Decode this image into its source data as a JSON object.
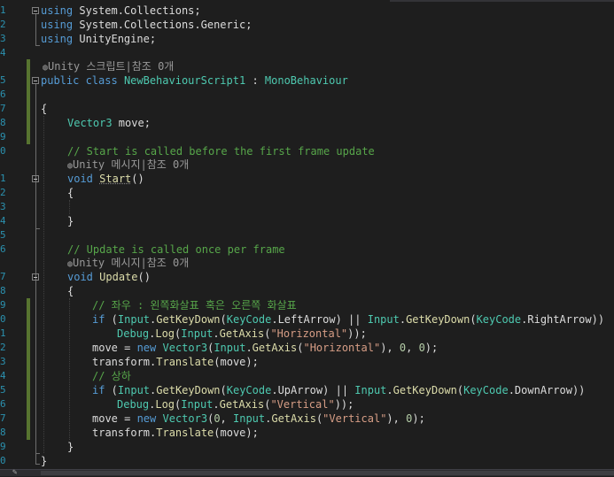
{
  "line_numbers": [
    "1",
    "2",
    "3",
    "4",
    "5",
    "6",
    "7",
    "8",
    "9",
    "0",
    "1",
    "2",
    "3",
    "4",
    "5",
    "6",
    "7",
    "8",
    "9",
    "0",
    "1",
    "2",
    "3",
    "4",
    "5",
    "6",
    "7",
    "8",
    "9",
    "0"
  ],
  "code": {
    "l1_kw": "using",
    "l1_rest": " System.Collections;",
    "l2_kw": "using",
    "l2_rest": " System.Collections.Generic;",
    "l3_kw": "using",
    "l3_rest": " UnityEngine;",
    "lens1_icon": "◍",
    "lens1_text": "Unity 스크립트|참조 0개",
    "l5_kw1": "public",
    "l5_kw2": " class ",
    "l5_type": "NewBehaviourScript1",
    "l5_colon": " : ",
    "l5_base": "MonoBehaviour",
    "l6_brace": "{",
    "l7_type": "Vector3",
    "l7_rest": " move;",
    "l9_comment": "// Start is called before the first frame update",
    "lens2_icon": "◍",
    "lens2_text": "Unity 메시지|참조 0개",
    "l10_kw": "void",
    "l10_fn": "Start",
    "l10_paren": "()",
    "l11_brace": "{",
    "l13_brace": "}",
    "l15_comment": "// Update is called once per frame",
    "lens3_icon": "◍",
    "lens3_text": "Unity 메시지|참조 0개",
    "l16_kw": "void",
    "l16_fn": "Update",
    "l16_paren": "()",
    "l17_brace": "{",
    "l18_comment": "// 좌우 : 왼쪽화살표 혹은 오른쪽 화살표",
    "l19_if": "if",
    "l19_p1": " (",
    "l19_input1": "Input",
    "l19_dot1": ".",
    "l19_fn1": "GetKeyDown",
    "l19_p2": "(",
    "l19_kc1": "KeyCode",
    "l19_dot2": ".",
    "l19_arg1": "LeftArrow",
    "l19_p3": ") || ",
    "l19_input2": "Input",
    "l19_dot3": ".",
    "l19_fn2": "GetKeyDown",
    "l19_p4": "(",
    "l19_kc2": "KeyCode",
    "l19_dot4": ".",
    "l19_arg2": "RightArrow",
    "l19_p5": "))",
    "l20_debug": "Debug",
    "l20_dot1": ".",
    "l20_log": "Log",
    "l20_p1": "(",
    "l20_input": "Input",
    "l20_dot2": ".",
    "l20_fn": "GetAxis",
    "l20_p2": "(",
    "l20_str": "\"Horizontal\"",
    "l20_p3": "));",
    "l21_a": "move = ",
    "l21_new": "new",
    "l21_sp": " ",
    "l21_type": "Vector3",
    "l21_p1": "(",
    "l21_input": "Input",
    "l21_dot": ".",
    "l21_fn": "GetAxis",
    "l21_p2": "(",
    "l21_str": "\"Horizontal\"",
    "l21_p3": "), ",
    "l21_z1": "0",
    "l21_c": ", ",
    "l21_z2": "0",
    "l21_p4": ");",
    "l22_a": "transform.",
    "l22_fn": "Translate",
    "l22_b": "(move);",
    "l23_comment": "// 상하",
    "l24_if": "if",
    "l24_p1": " (",
    "l24_input1": "Input",
    "l24_dot1": ".",
    "l24_fn1": "GetKeyDown",
    "l24_p2": "(",
    "l24_kc1": "KeyCode",
    "l24_dot2": ".",
    "l24_arg1": "UpArrow",
    "l24_p3": ") || ",
    "l24_input2": "Input",
    "l24_dot3": ".",
    "l24_fn2": "GetKeyDown",
    "l24_p4": "(",
    "l24_kc2": "KeyCode",
    "l24_dot4": ".",
    "l24_arg2": "DownArrow",
    "l24_p5": "))",
    "l25_debug": "Debug",
    "l25_dot1": ".",
    "l25_log": "Log",
    "l25_p1": "(",
    "l25_input": "Input",
    "l25_dot2": ".",
    "l25_fn": "GetAxis",
    "l25_p2": "(",
    "l25_str": "\"Vertical\"",
    "l25_p3": "));",
    "l26_a": "move = ",
    "l26_new": "new",
    "l26_sp": " ",
    "l26_type": "Vector3",
    "l26_p1": "(",
    "l26_z1": "0",
    "l26_c": ", ",
    "l26_input": "Input",
    "l26_dot": ".",
    "l26_fn": "GetAxis",
    "l26_p2": "(",
    "l26_str": "\"Vertical\"",
    "l26_p3": "), ",
    "l26_z2": "0",
    "l26_p4": ");",
    "l27_a": "transform.",
    "l27_fn": "Translate",
    "l27_b": "(move);",
    "l28_brace": "}",
    "l29_brace": "}"
  },
  "scrollbar": {
    "pen_icon": "✎"
  },
  "colors": {
    "background": "#1e1e1e",
    "keyword": "#569cd6",
    "type": "#4ec9b0",
    "comment": "#57a64a",
    "string": "#d69d85",
    "line_number": "#2b91af",
    "change_bar": "#577430"
  }
}
